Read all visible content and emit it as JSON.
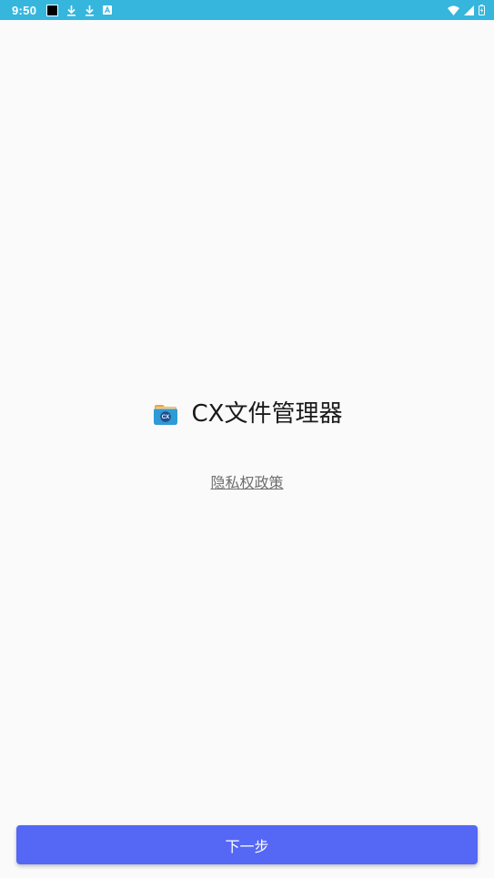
{
  "status_bar": {
    "time": "9:50",
    "background_color": "#36b6dd",
    "left_icons": [
      "black-square-icon",
      "download-icon",
      "download-icon",
      "a-letter-icon"
    ],
    "right_icons": [
      "wifi-icon",
      "signal-icon",
      "battery-icon"
    ]
  },
  "app": {
    "logo_icon": "cx-folder-icon",
    "logo_text": "CX",
    "name": "CX文件管理器"
  },
  "privacy": {
    "link_label": "隐私权政策"
  },
  "footer": {
    "next_label": "下一步",
    "button_color": "#5467f5"
  }
}
